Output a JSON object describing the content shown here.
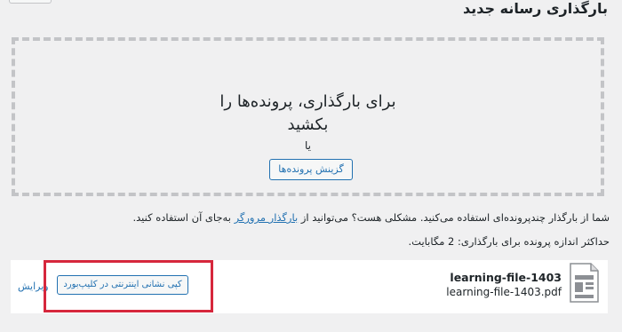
{
  "page": {
    "title": "بارگذاری رسانه جدید"
  },
  "uploader": {
    "drop_text_line1": "برای بارگذاری، پرونده‌ها را",
    "drop_text_line2": "بکشید",
    "or_text": "یا",
    "select_button": "گزینش پرونده‌ها"
  },
  "notices": {
    "multi_uploader_prefix": "شما از بارگذار چندپرونده‌ای استفاده می‌کنید. مشکلی هست؟ می‌توانید از",
    "browser_uploader_link": "بارگذار مرورگر",
    "multi_uploader_suffix": "به‌جای آن استفاده کنید.",
    "max_upload_size": "حداکثر اندازه پرونده برای بارگذاری: 2 مگابایت."
  },
  "media_item": {
    "icon": "document-icon",
    "title": "learning-file-1403",
    "filename": "learning-file-1403.pdf",
    "copy_url_button": "کپی نشانی اینترنتی در کلیپ‌بورد",
    "edit_link": "ویرایش"
  },
  "colors": {
    "accent": "#2271b1",
    "background": "#f0f0f1",
    "highlight": "#d6273c"
  }
}
